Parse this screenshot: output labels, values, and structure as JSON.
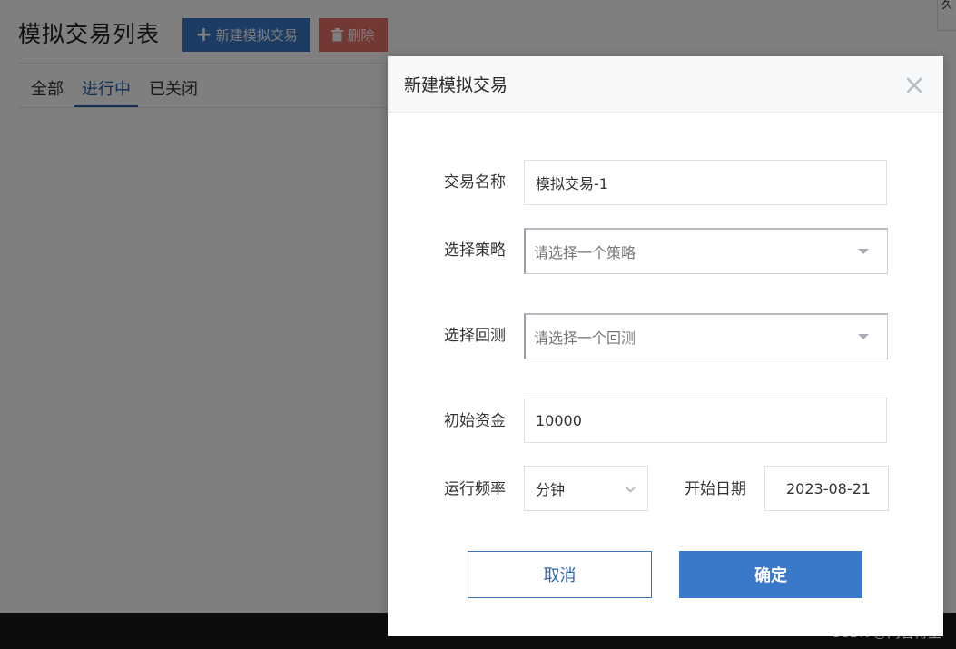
{
  "page": {
    "title": "模拟交易列表",
    "new_button": "新建模拟交易",
    "delete_button": "删除",
    "tabs": [
      "全部",
      "进行中",
      "已关闭"
    ],
    "active_tab": "进行中",
    "corner_text": "久"
  },
  "modal": {
    "title": "新建模拟交易",
    "close_icon": "close-icon",
    "fields": {
      "name": {
        "label": "交易名称",
        "value": "模拟交易-1"
      },
      "strategy": {
        "label": "选择策略",
        "placeholder": "请选择一个策略"
      },
      "backtest": {
        "label": "选择回测",
        "placeholder": "请选择一个回测"
      },
      "capital": {
        "label": "初始资金",
        "value": "10000"
      },
      "frequency": {
        "label": "运行频率",
        "value": "分钟"
      },
      "start_date": {
        "label": "开始日期",
        "value": "2023-08-21"
      }
    },
    "cancel_label": "取消",
    "confirm_label": "确定"
  },
  "watermark": "CSDN @问答博主",
  "colors": {
    "primary": "#3a78c9",
    "danger": "#e57368",
    "active_tab": "#2a5aa8",
    "overlay": "rgba(0,0,0,0.5)"
  }
}
